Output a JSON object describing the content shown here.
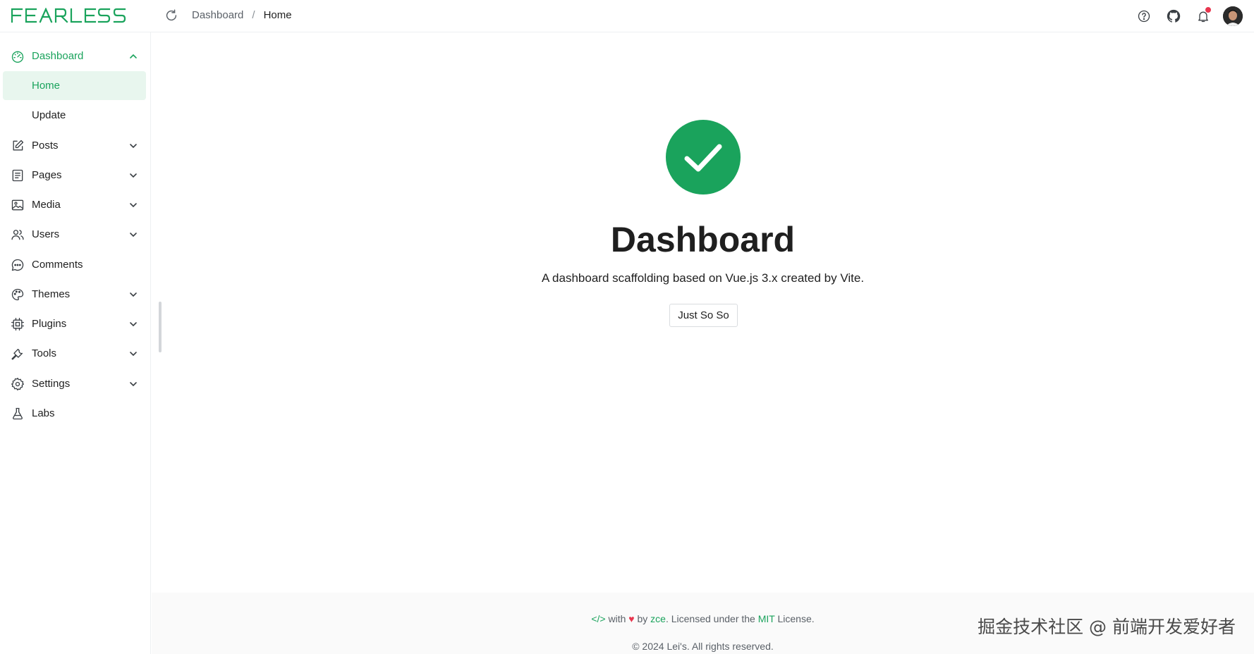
{
  "brand": {
    "logo_text": "FEARLESS",
    "accent": "#1aa35c"
  },
  "header": {
    "reload_icon": "reload-icon",
    "breadcrumb": {
      "parent": "Dashboard",
      "separator": "/",
      "current": "Home"
    },
    "icons": [
      "help-icon",
      "github-icon",
      "bell-icon",
      "avatar"
    ]
  },
  "sidebar": {
    "items": [
      {
        "label": "Dashboard",
        "icon": "dashboard-icon",
        "expanded": true
      },
      {
        "label": "Home",
        "sub": true,
        "selected": true
      },
      {
        "label": "Update",
        "sub": true
      },
      {
        "label": "Posts",
        "icon": "posts-icon"
      },
      {
        "label": "Pages",
        "icon": "pages-icon"
      },
      {
        "label": "Media",
        "icon": "media-icon"
      },
      {
        "label": "Users",
        "icon": "users-icon"
      },
      {
        "label": "Comments",
        "icon": "comments-icon"
      },
      {
        "label": "Themes",
        "icon": "themes-icon"
      },
      {
        "label": "Plugins",
        "icon": "plugins-icon"
      },
      {
        "label": "Tools",
        "icon": "tools-icon"
      },
      {
        "label": "Settings",
        "icon": "settings-icon"
      },
      {
        "label": "Labs",
        "icon": "labs-icon"
      }
    ]
  },
  "main": {
    "title": "Dashboard",
    "subtitle": "A dashboard scaffolding based on Vue.js 3.x created by Vite.",
    "button_label": "Just So So",
    "success_color": "#1aa35c"
  },
  "footer": {
    "code": "</>",
    "with": "with",
    "heart": "♥",
    "by": "by",
    "author": "zce",
    "licensed": ". Licensed under the",
    "license": "MIT",
    "license_suffix": "License.",
    "copyright": "© 2024 Lei's. All rights reserved."
  },
  "watermark": "掘金技术社区 @ 前端开发爱好者"
}
